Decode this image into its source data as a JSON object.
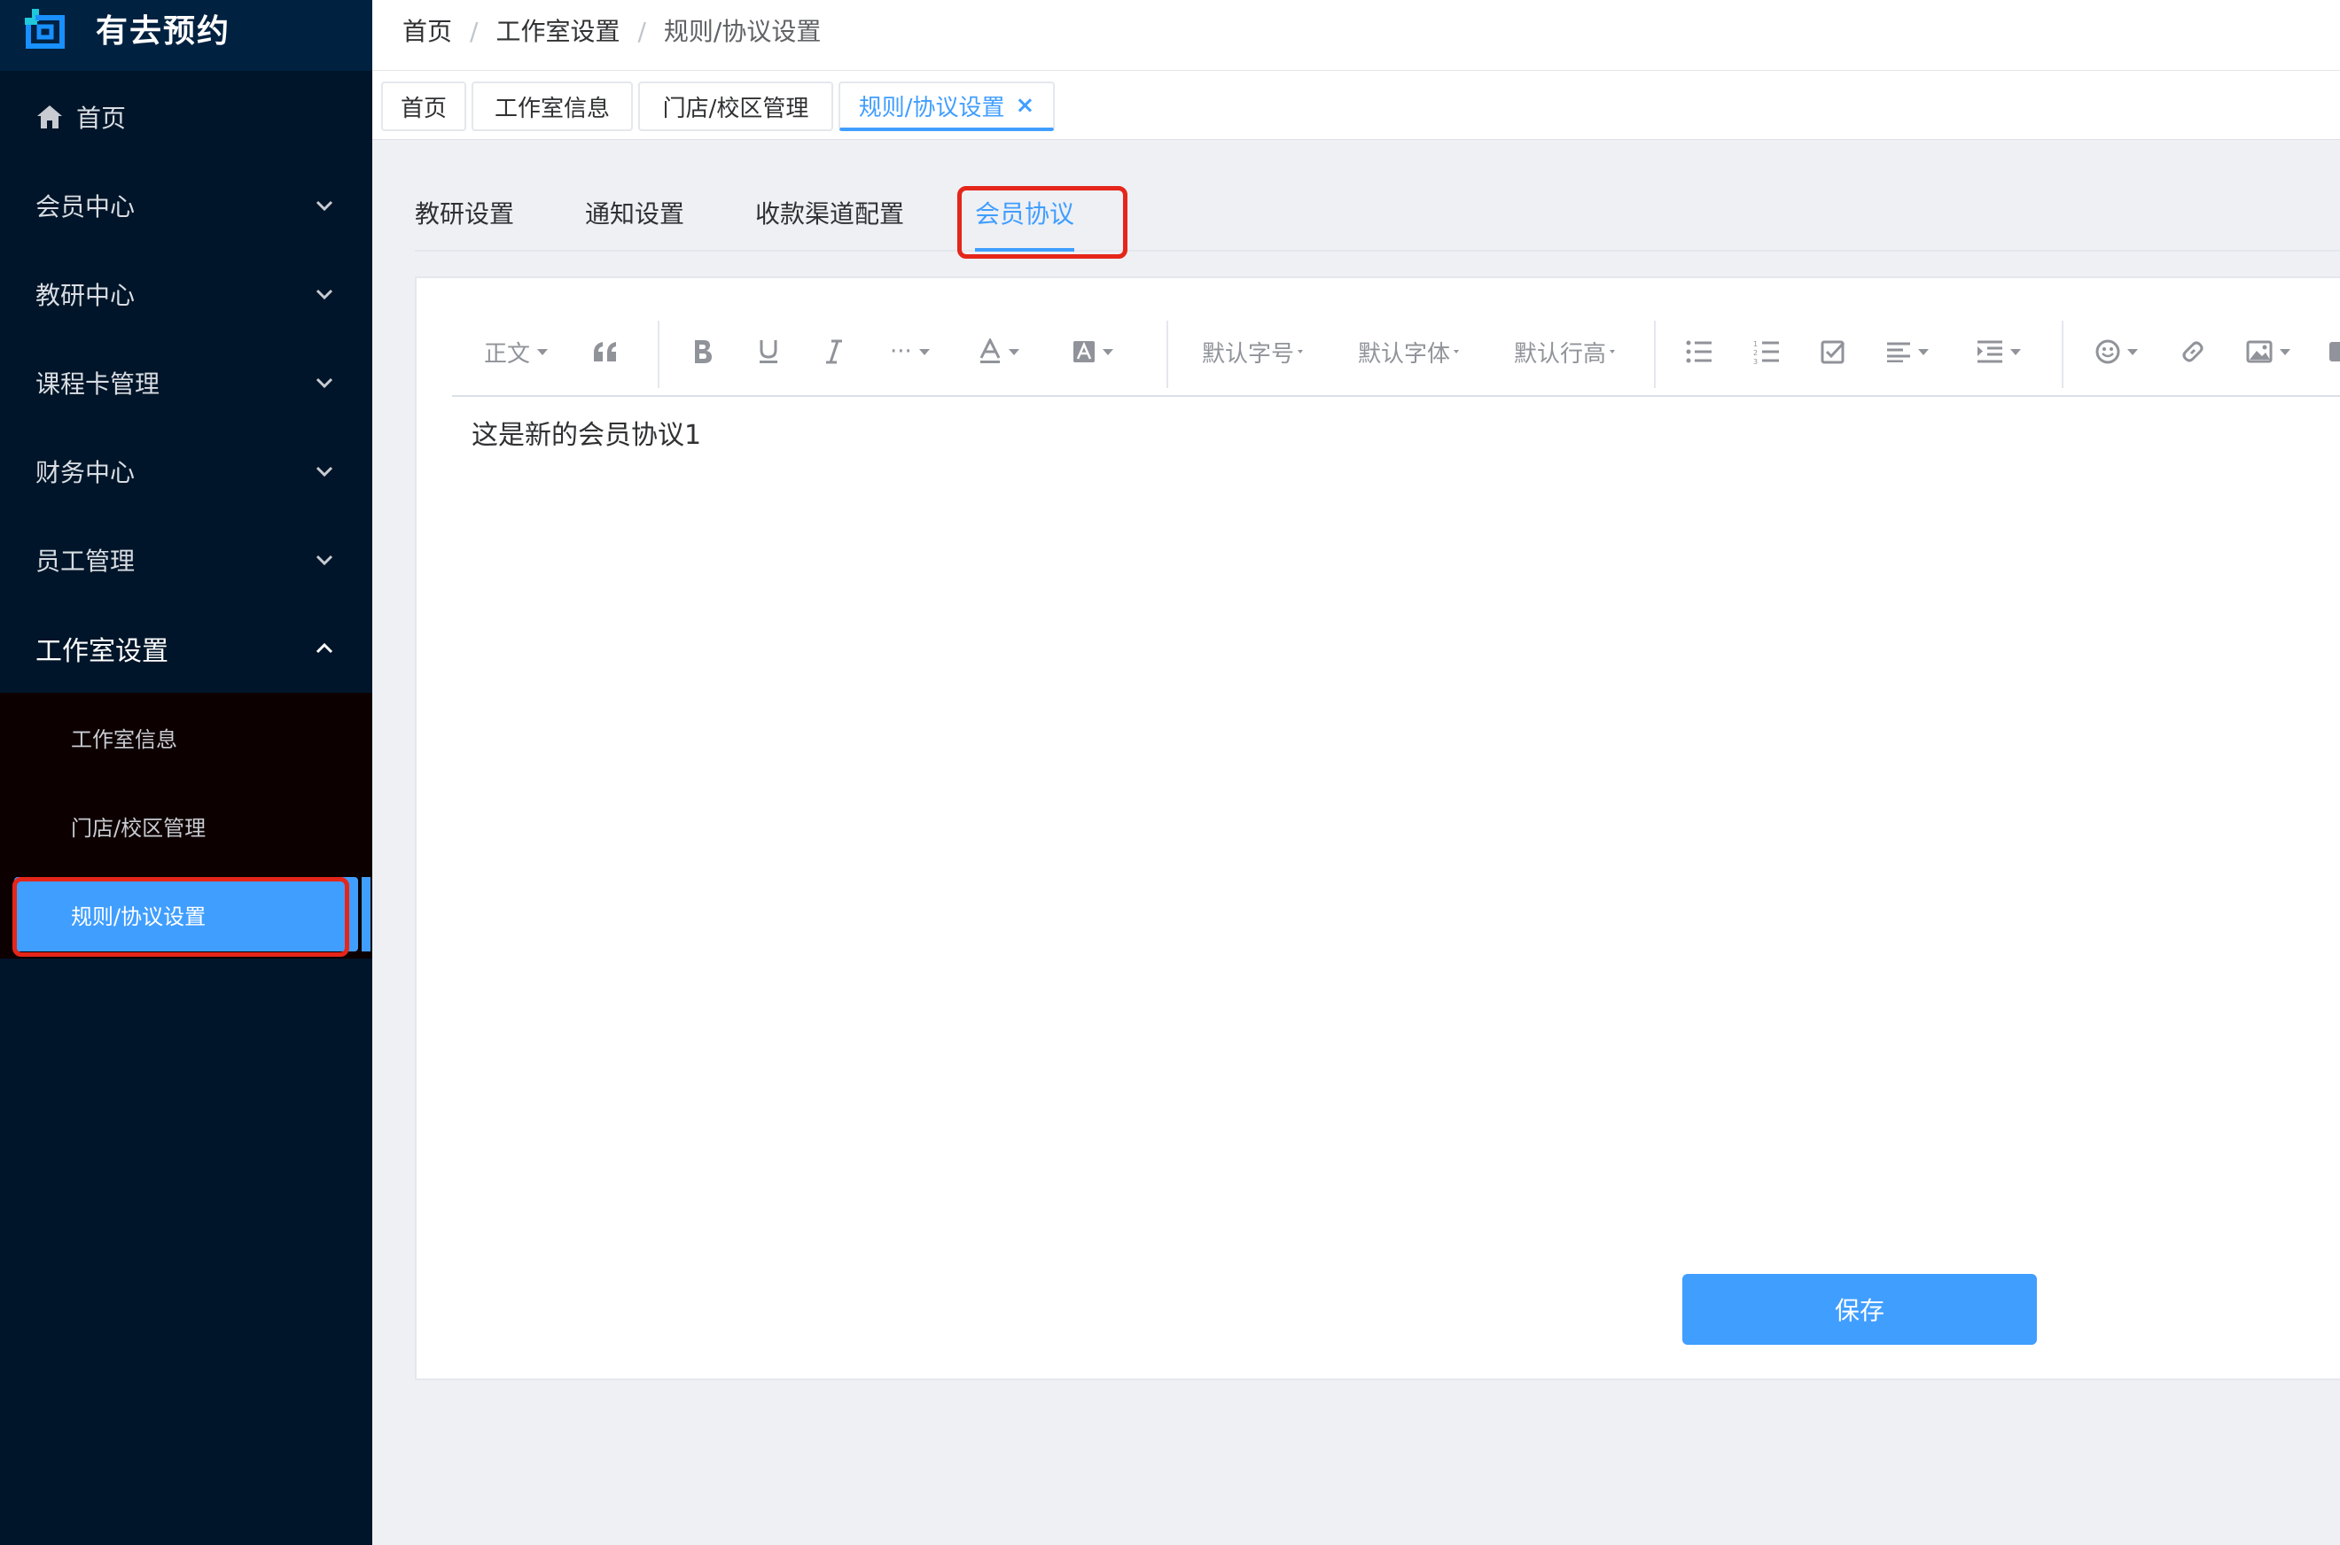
{
  "app": {
    "title": "有去预约"
  },
  "colors": {
    "sidebar": "#001529",
    "accent": "#409eff",
    "highlight": "#e5261a"
  },
  "sidebar": {
    "home": "首页",
    "items": [
      {
        "label": "会员中心"
      },
      {
        "label": "教研中心"
      },
      {
        "label": "课程卡管理"
      },
      {
        "label": "财务中心"
      },
      {
        "label": "员工管理"
      },
      {
        "label": "工作室设置"
      }
    ],
    "submenu": [
      {
        "label": "工作室信息"
      },
      {
        "label": "门店/校区管理"
      },
      {
        "label": "规则/协议设置"
      }
    ]
  },
  "breadcrumb": [
    "首页",
    "工作室设置",
    "规则/协议设置"
  ],
  "tags": [
    {
      "label": "首页"
    },
    {
      "label": "工作室信息"
    },
    {
      "label": "门店/校区管理"
    },
    {
      "label": "规则/协议设置",
      "close": "×"
    }
  ],
  "tabs": [
    {
      "label": "教研设置"
    },
    {
      "label": "通知设置"
    },
    {
      "label": "收款渠道配置"
    },
    {
      "label": "会员协议"
    }
  ],
  "toolbar": {
    "paragraph": "正文",
    "more": "···",
    "font_size": "默认字号",
    "font_family": "默认字体",
    "line_height": "默认行高"
  },
  "editor": {
    "content": "这是新的会员协议1"
  },
  "actions": {
    "save": "保存"
  }
}
